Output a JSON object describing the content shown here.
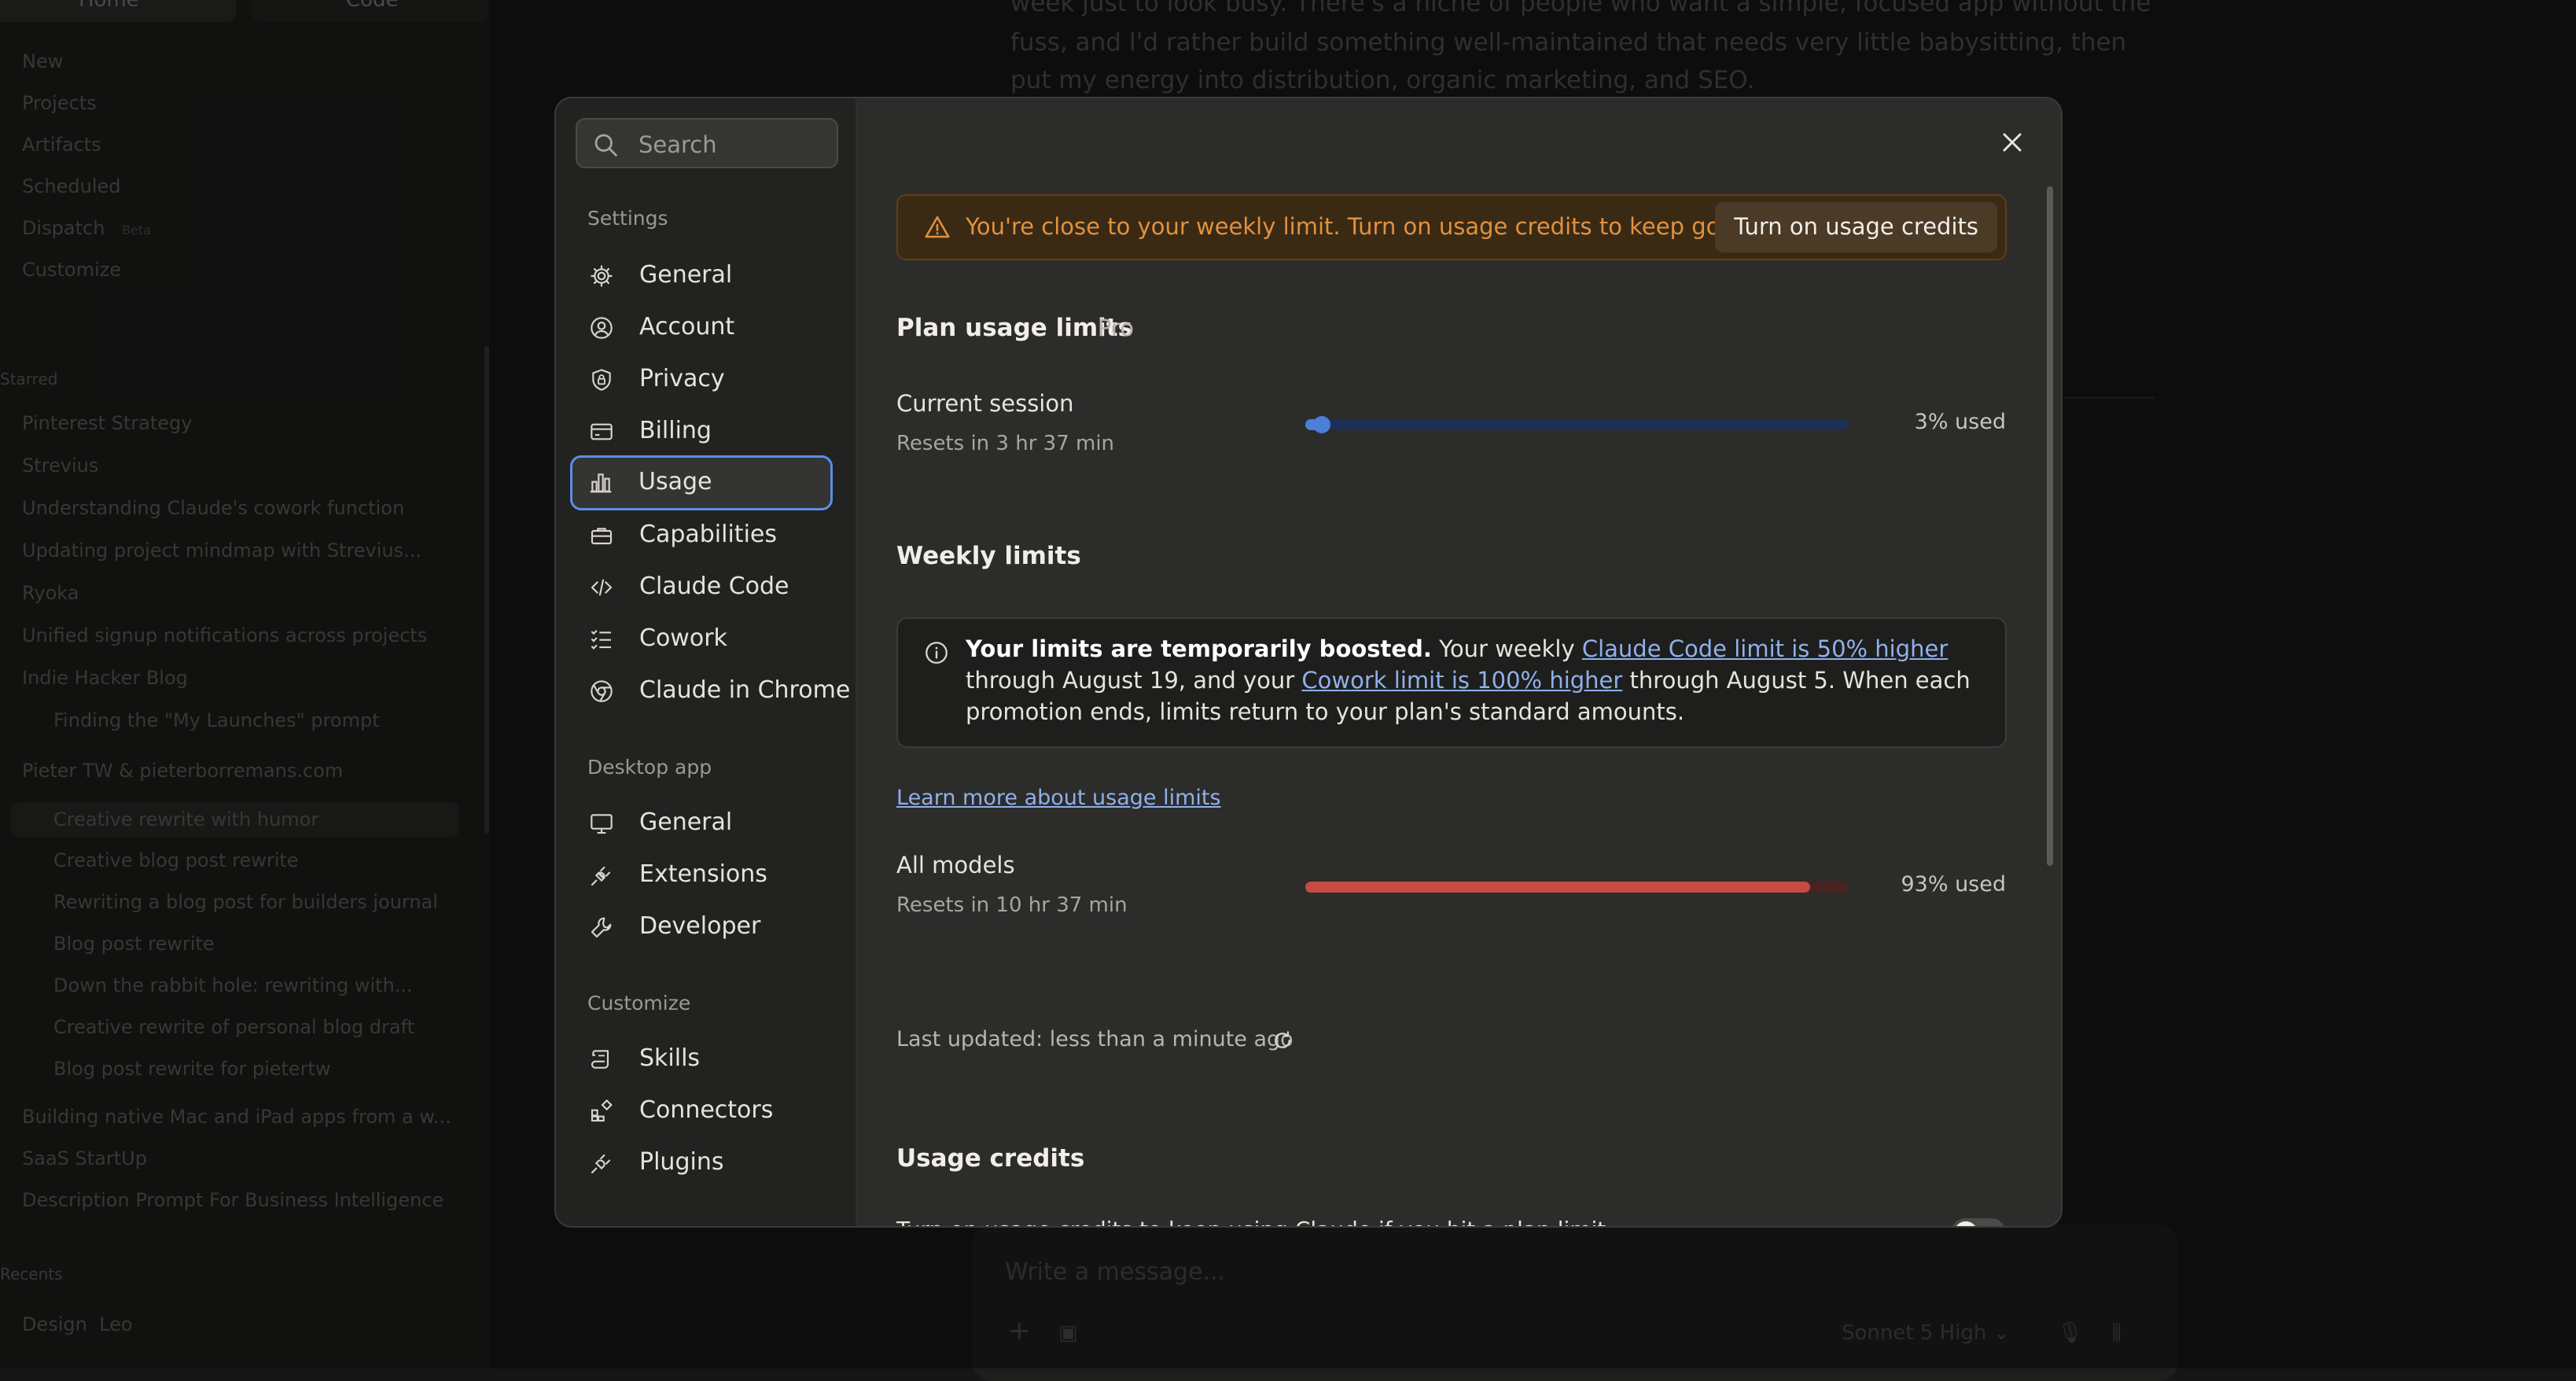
{
  "background": {
    "top_tabs": [
      "Home",
      "Code"
    ],
    "nav_items": [
      "New",
      "Projects",
      "Artifacts",
      "Scheduled",
      "Dispatch",
      "Customize"
    ],
    "dispatch_badge": "Beta",
    "starred_label": "Starred",
    "recents_label": "Recents",
    "conversations": [
      "Pinterest Strategy",
      "Strevius",
      "Understanding Claude's cowork function",
      "Updating project mindmap with Strevius...",
      "Ryoka",
      "Unified signup notifications across projects",
      "Indie Hacker Blog",
      "Finding the \"My Launches\" prompt",
      "Pieter TW & pieterborremans.com",
      "Creative rewrite with humor",
      "Creative blog post rewrite",
      "Rewriting a blog post for builders journal",
      "Blog post rewrite",
      "Down the rabbit hole: rewriting with...",
      "Creative rewrite of personal blog draft",
      "Blog post rewrite for pietertw",
      "Building native Mac and iPad apps from a w...",
      "SaaS StartUp",
      "Description Prompt For Business Intelligence"
    ],
    "recents_items": [
      "Design",
      "Leo"
    ],
    "chat_lines": [
      "week just to look busy. There's a niche of people who want a simple, focused app without the",
      "fuss, and I'd rather build something well-maintained that needs very little babysitting, then",
      "put my energy into distribution, organic marketing, and SEO."
    ],
    "input_placeholder": "Write a message...",
    "model_label": "Sonnet 5",
    "effort_label": "High"
  },
  "modal": {
    "search_placeholder": "Search",
    "sections": {
      "settings": "Settings",
      "desktop": "Desktop app",
      "customize": "Customize"
    },
    "settings_items": [
      "General",
      "Account",
      "Privacy",
      "Billing",
      "Usage",
      "Capabilities",
      "Claude Code",
      "Cowork",
      "Claude in Chrome"
    ],
    "desktop_items": [
      "General",
      "Extensions",
      "Developer"
    ],
    "customize_items": [
      "Skills",
      "Connectors",
      "Plugins"
    ],
    "active_item": "Usage",
    "banner": {
      "text": "You're close to your weekly limit. Turn on usage credits to keep going.",
      "button": "Turn on usage credits"
    },
    "plan": {
      "title": "Plan usage limits",
      "tier": "Pro"
    },
    "current_session": {
      "label": "Current session",
      "reset": "Resets in 3 hr 37 min",
      "used_fraction": 0.03,
      "used_text": "3% used"
    },
    "weekly": {
      "title": "Weekly limits"
    },
    "boost": {
      "bold": "Your limits are temporarily boosted.",
      "t1": " Your weekly ",
      "link1": "Claude Code limit is 50% higher",
      "t2": " through August 19, and your ",
      "link2": "Cowork limit is 100% higher",
      "t3": " through August 5. When each promotion ends, limits return to your plan's standard amounts."
    },
    "learn_more": "Learn more about usage limits",
    "all_models": {
      "label": "All models",
      "reset": "Resets in 10 hr 37 min",
      "used_fraction": 0.93,
      "used_text": "93% used"
    },
    "last_updated": "Last updated: less than a minute ago",
    "credits": {
      "title": "Usage credits",
      "desc_partial": "Turn on usage credits to keep using Claude if you hit a plan limit."
    },
    "colors": {
      "accent_blue": "#5b8ee6",
      "session_fill": "#4a7fd8",
      "session_track": "#1c2f57",
      "weekly_fill": "#c64b44",
      "weekly_track": "#4a2220",
      "warning": "#e0913f"
    }
  }
}
